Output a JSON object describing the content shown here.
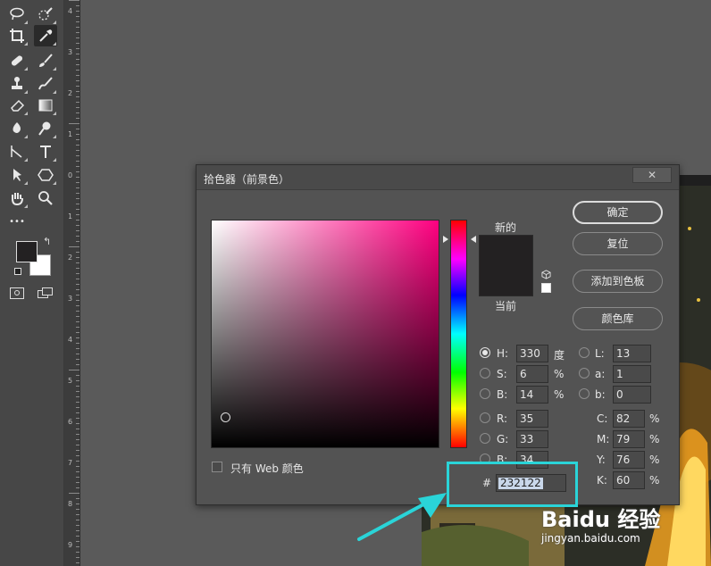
{
  "ruler": {
    "numbers": [
      "4",
      "3",
      "2",
      "1",
      "0",
      "1",
      "2",
      "3",
      "4",
      "5",
      "6",
      "7",
      "8",
      "9"
    ]
  },
  "tools": [
    {
      "name": "lasso-icon"
    },
    {
      "name": "quick-select-icon"
    },
    {
      "name": "crop-icon"
    },
    {
      "name": "eyedropper-icon"
    },
    {
      "name": "healing-brush-icon"
    },
    {
      "name": "brush-icon"
    },
    {
      "name": "clone-stamp-icon"
    },
    {
      "name": "history-brush-icon"
    },
    {
      "name": "eraser-icon"
    },
    {
      "name": "gradient-icon"
    },
    {
      "name": "blur-icon"
    },
    {
      "name": "dodge-icon"
    },
    {
      "name": "pen-icon"
    },
    {
      "name": "type-icon"
    },
    {
      "name": "path-select-icon"
    },
    {
      "name": "shape-icon"
    },
    {
      "name": "hand-icon"
    },
    {
      "name": "zoom-icon"
    }
  ],
  "toolbar": {
    "more_label": "•••"
  },
  "dialog": {
    "title": "拾色器（前景色）",
    "close_label": "✕",
    "new_label": "新的",
    "current_label": "当前",
    "buttons": {
      "ok": "确定",
      "reset": "复位",
      "add": "添加到色板",
      "library": "颜色库"
    },
    "web_only_label": "只有 Web 颜色",
    "hash_label": "#",
    "hex_value": "232122",
    "swatch_color": "#232122",
    "fields": {
      "H": {
        "label": "H:",
        "value": "330",
        "unit": "度"
      },
      "S": {
        "label": "S:",
        "value": "6",
        "unit": "%"
      },
      "B": {
        "label": "B:",
        "value": "14",
        "unit": "%"
      },
      "R": {
        "label": "R:",
        "value": "35"
      },
      "G": {
        "label": "G:",
        "value": "33"
      },
      "Bb": {
        "label": "B:",
        "value": "34"
      },
      "L": {
        "label": "L:",
        "value": "13"
      },
      "a": {
        "label": "a:",
        "value": "1"
      },
      "b": {
        "label": "b:",
        "value": "0"
      },
      "C": {
        "label": "C:",
        "value": "82",
        "unit": "%"
      },
      "M": {
        "label": "M:",
        "value": "79",
        "unit": "%"
      },
      "Y": {
        "label": "Y:",
        "value": "76",
        "unit": "%"
      },
      "K": {
        "label": "K:",
        "value": "60",
        "unit": "%"
      }
    }
  },
  "watermark": {
    "logo": "Baidu 经验",
    "url": "jingyan.baidu.com"
  },
  "colors": {
    "highlight": "#2ad4d8",
    "hue_top": "#ff0080"
  }
}
